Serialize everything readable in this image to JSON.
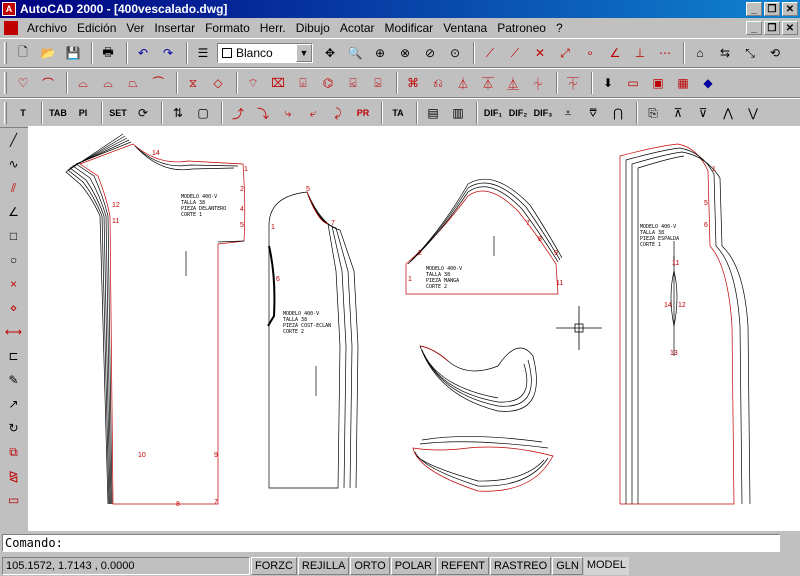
{
  "window": {
    "title": "AutoCAD 2000 - [400vescalado.dwg]",
    "app_icon": "autocad-logo-icon"
  },
  "menu": [
    "Archivo",
    "Edición",
    "Ver",
    "Insertar",
    "Formato",
    "Herr.",
    "Dibujo",
    "Acotar",
    "Modificar",
    "Ventana",
    "Patroneo",
    "?"
  ],
  "layer_combo": {
    "value": "Blanco"
  },
  "canvas_labels": {
    "front_piece": "MODELO 400-V\nTALLA 38\nPIEZA DELANTERO\nCORTE 1",
    "side_piece": "MODELO 400-V\nTALLA 38\nPIEZA COST-ECLAN\nCORTE 2\n",
    "sleeve": "MODELO 400-V\nTALLA 38\nPIEZA MANGA\nCORTE 2",
    "back_piece": "MODELO 400-V\nTALLA 38\nPIEZA ESPALDA\nCORTE 1"
  },
  "point_numbers": {
    "front": [
      "14",
      "1",
      "2",
      "4",
      "5",
      "12",
      "11",
      "10",
      "9",
      "8",
      "7"
    ],
    "side": [
      "5",
      "1",
      "7",
      "6"
    ],
    "sleeve": [
      "2",
      "7",
      "8",
      "9",
      "1",
      "11"
    ],
    "back": [
      "1",
      "5",
      "6",
      "14",
      "12",
      "11",
      "13"
    ]
  },
  "command": {
    "prompt": "Comando:"
  },
  "status": {
    "coords": "105.1572, 1.7143 , 0.0000",
    "modes": [
      "FORZC",
      "REJILLA",
      "ORTO",
      "POLAR",
      "REFENT",
      "RASTREO",
      "GLN",
      "MODEL"
    ]
  },
  "colors": {
    "title_bar": "#000080",
    "pattern_red": "#c00000",
    "canvas_bg": "#ffffff"
  }
}
